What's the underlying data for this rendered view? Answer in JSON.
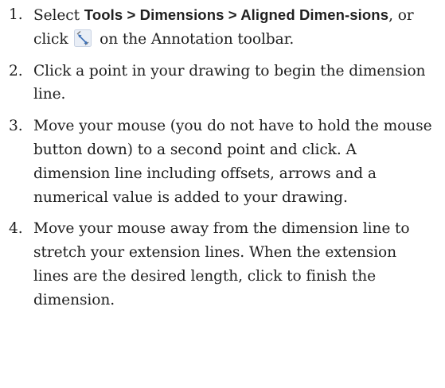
{
  "steps": [
    {
      "number": "1.",
      "parts": {
        "text_a": "Select ",
        "menu_path": "Tools > Dimensions > Aligned Dimen-sions",
        "text_b": ", or click ",
        "icon": "aligned-dimension-icon",
        "text_c": " on the Annotation toolbar."
      }
    },
    {
      "number": "2.",
      "text": "Click a point in your drawing to begin the dimension line."
    },
    {
      "number": "3.",
      "text": "Move your mouse (you do not have to hold the mouse button down) to a second point and click. A dimension line including offsets, arrows and a numerical value is added to your drawing."
    },
    {
      "number": "4.",
      "text": "Move your mouse away from the dimension line to stretch your extension lines. When the extension lines are the desired length, click to finish the dimension."
    }
  ],
  "colors": {
    "text": "#1f1f1f",
    "icon_blue": "#3b6fb6",
    "icon_highlight": "#e9eef6"
  }
}
